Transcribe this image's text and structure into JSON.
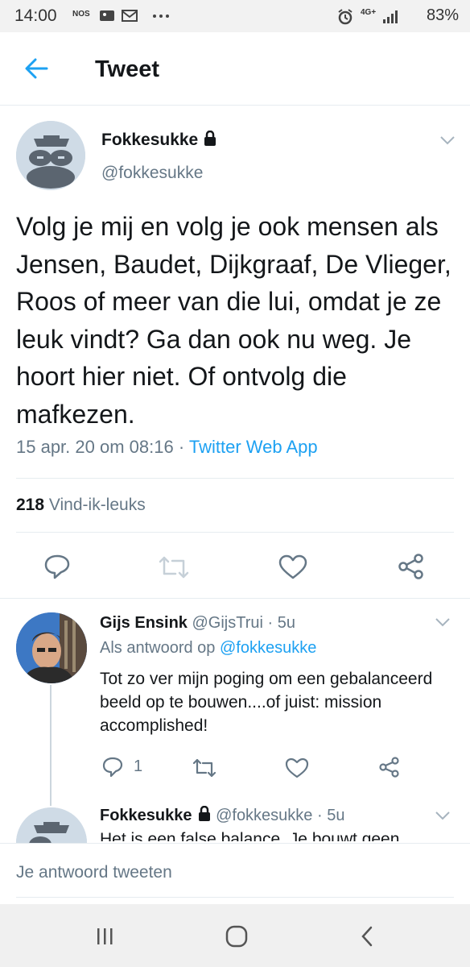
{
  "statusbar": {
    "time": "14:00",
    "carrier": "NOS",
    "network": "4G+",
    "battery": "83%"
  },
  "header": {
    "title": "Tweet"
  },
  "tweet": {
    "author_name": "Fokkesukke",
    "author_handle": "@fokkesukke",
    "text": "Volg je mij en volg je ook mensen als Jensen, Baudet, Dijkgraaf, De Vlieger, Roos of meer van die lui, omdat je ze leuk vindt? Ga dan ook nu weg. Je hoort hier niet. Of ontvolg die mafkezen.",
    "date": "15 apr. 20 om 08:16",
    "separator": " · ",
    "source": "Twitter Web App",
    "likes_count": "218",
    "likes_label": " Vind-ik-leuks"
  },
  "replies": [
    {
      "name": "Gijs Ensink",
      "handle": "@GijsTrui",
      "time": " · 5u",
      "in_reply_prefix": "Als antwoord op ",
      "in_reply_to": "@fokkesukke",
      "text": "Tot zo ver mijn poging om een gebalanceerd beeld op te bouwen....of juist: mission accomplished!",
      "reply_count": "1"
    },
    {
      "name": "Fokkesukke",
      "handle": "@fokkesukke",
      "time": " · 5u",
      "text": "Het is een false balance. Je bouwt geen"
    }
  ],
  "composer": {
    "placeholder": "Je antwoord tweeten"
  },
  "colors": {
    "accent": "#1da1f2",
    "muted": "#657786",
    "text": "#14171a"
  },
  "icons": [
    "back-arrow-icon",
    "lock-icon",
    "chevron-down-icon",
    "reply-icon",
    "retweet-icon",
    "like-icon",
    "share-icon",
    "recent-apps-icon",
    "home-icon",
    "back-icon"
  ]
}
